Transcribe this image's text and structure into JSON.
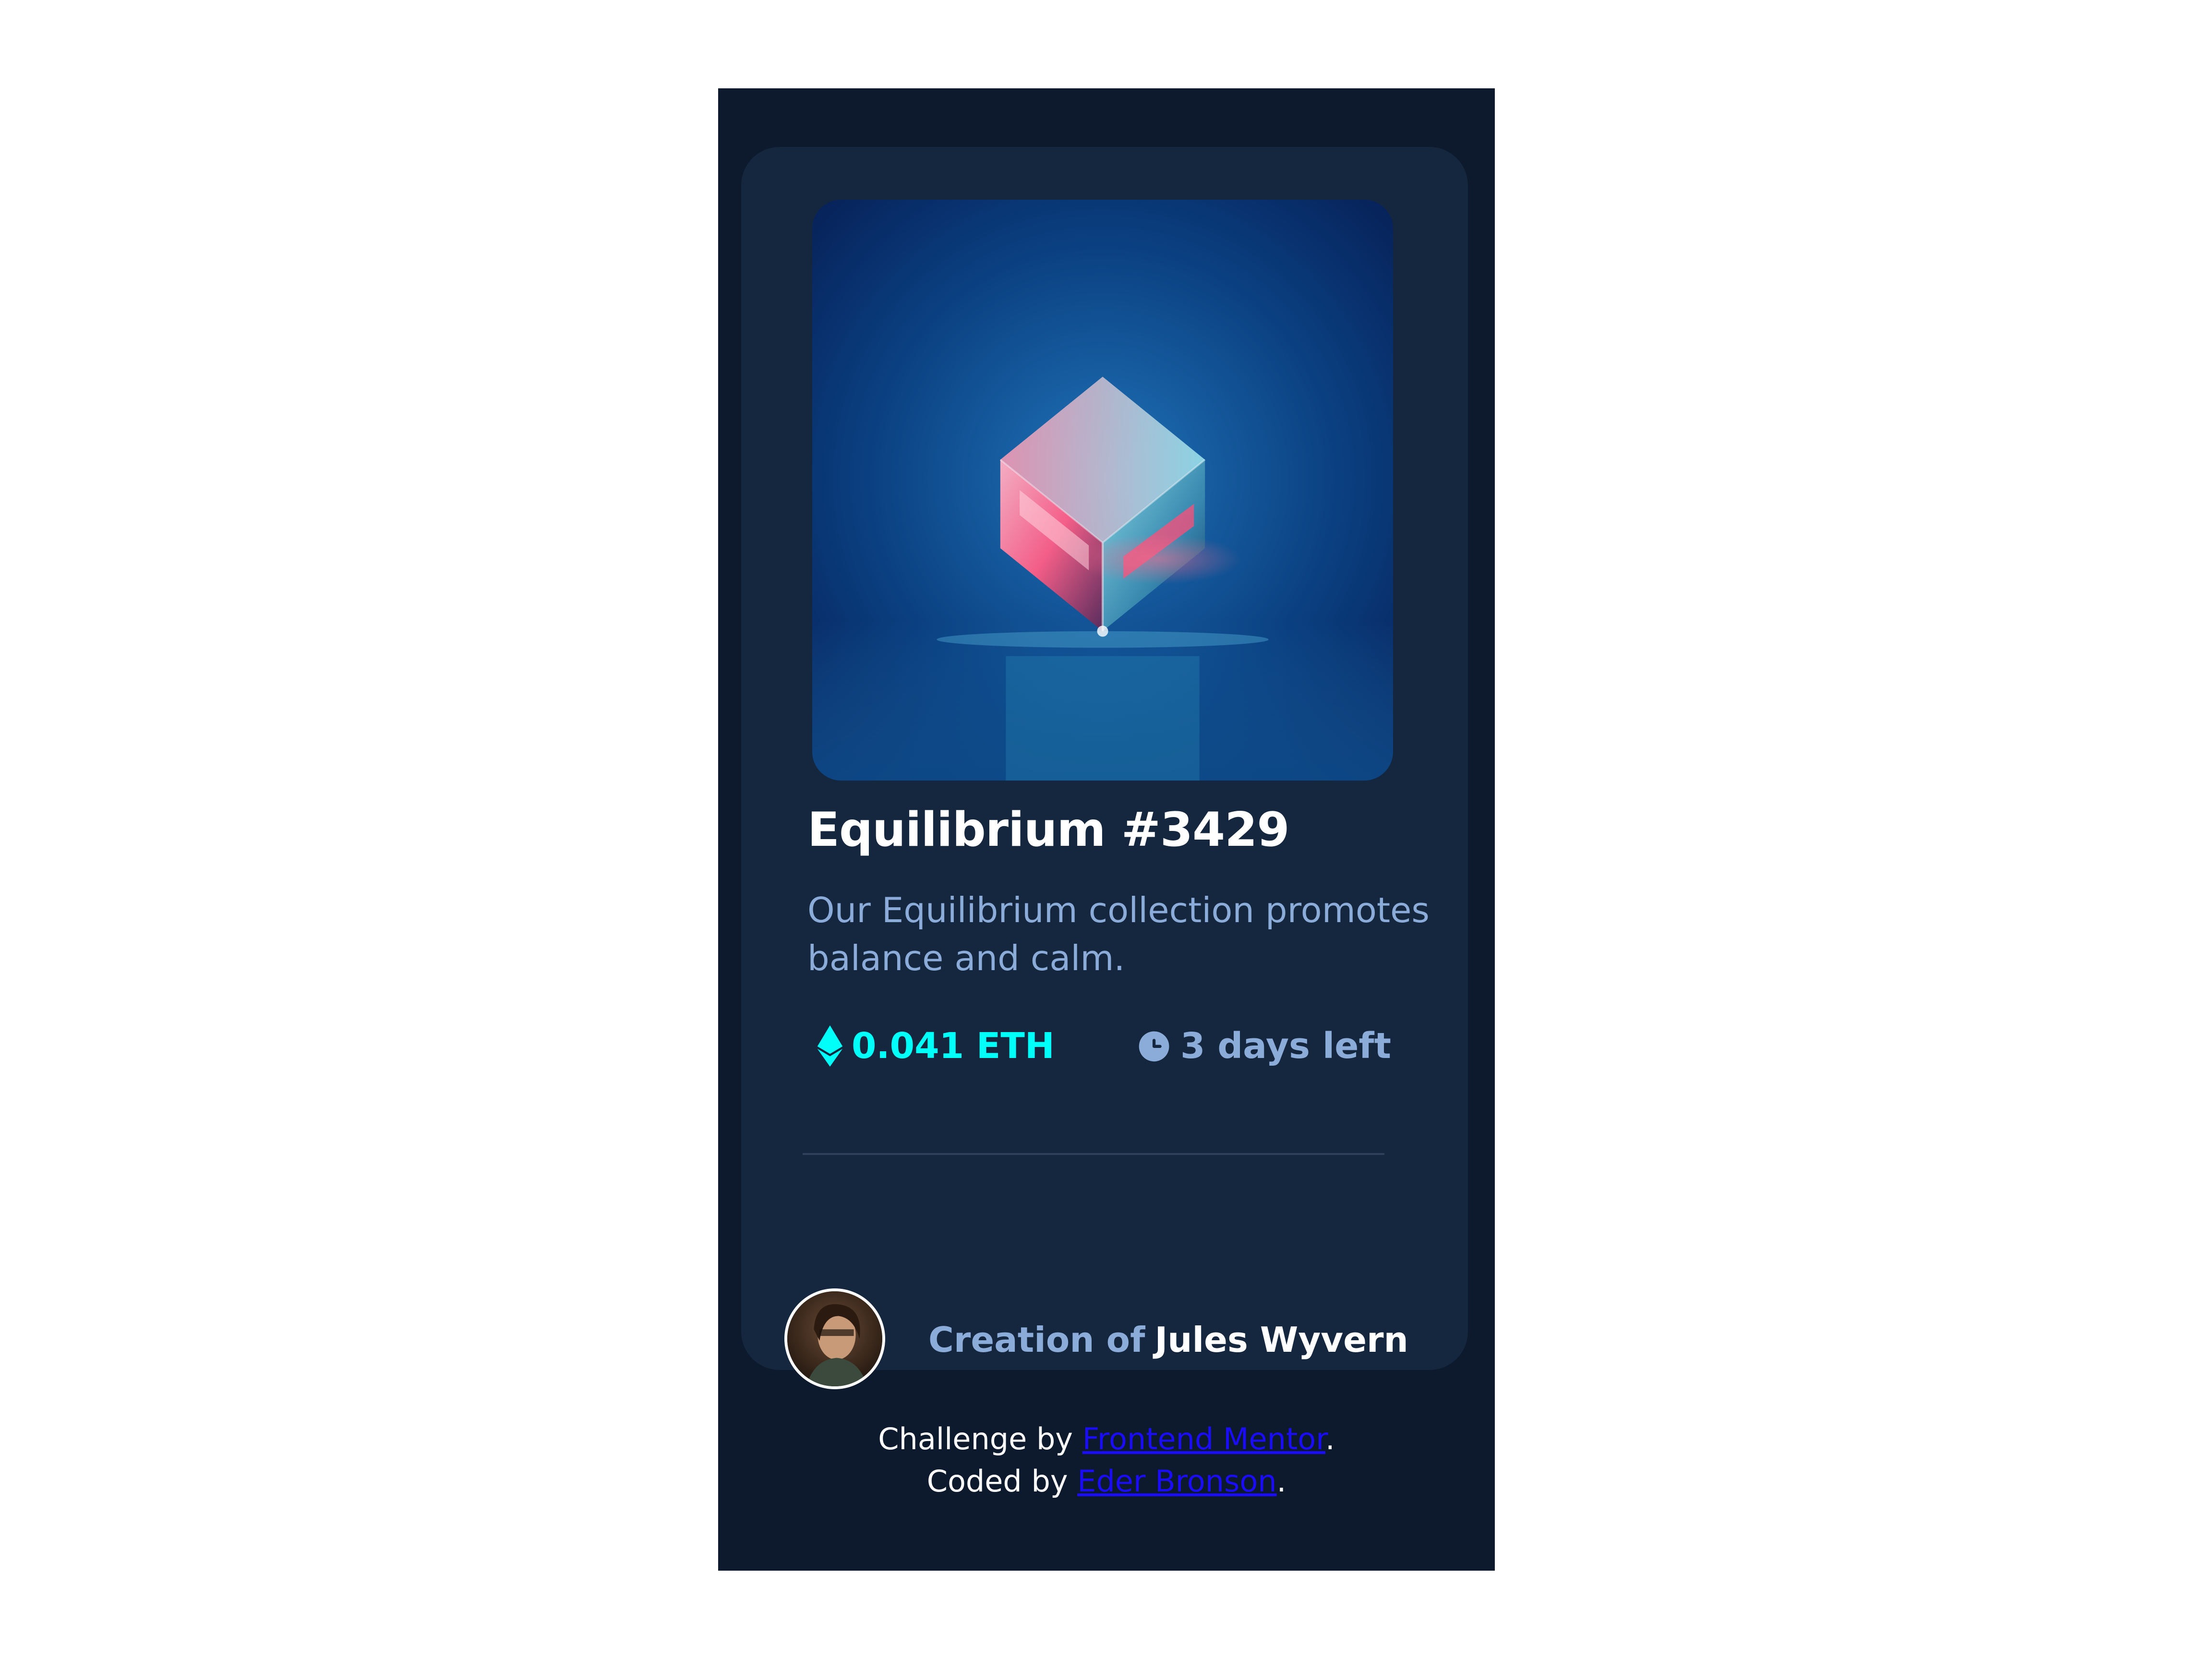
{
  "card": {
    "title": "Equilibrium #3429",
    "description_lines": [
      "Our Equilibrium collection promotes",
      "balance and calm."
    ],
    "price": "0.041 ETH",
    "time_left": "3 days left",
    "creator_prefix": "Creation of",
    "creator_name": "Jules Wyvern",
    "hero_image": "equilibrium-cube-image",
    "price_icon": "ethereum-icon",
    "time_icon": "clock-icon"
  },
  "attribution": {
    "challenge_prefix": "Challenge by",
    "challenge_link": "Frontend Mentor",
    "challenge_suffix": ".",
    "coded_prefix": "Coded by",
    "coded_link": "Eder Bronson",
    "coded_suffix": "."
  },
  "colors": {
    "page_background": "#ffffff",
    "main_background": "#0d192c",
    "card_background": "#15263f",
    "heading": "#ffffff",
    "soft_blue": "#8bacd9",
    "cyan": "#00fff8",
    "link": "#1a0df5"
  }
}
